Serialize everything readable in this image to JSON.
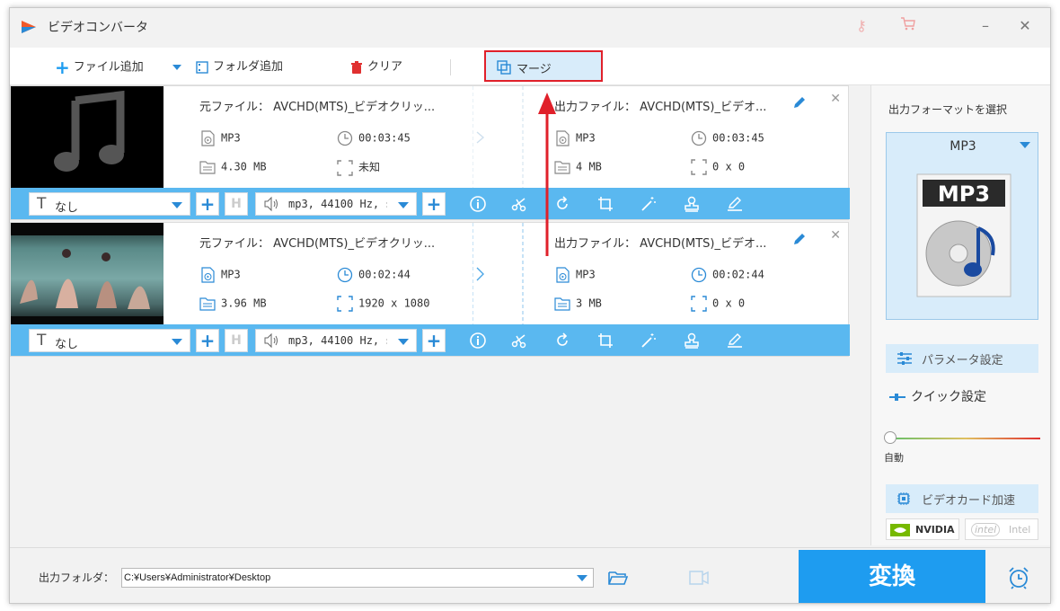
{
  "app": {
    "title": "ビデオコンバータ"
  },
  "toolbar": {
    "add_file": "ファイル追加",
    "add_folder": "フォルダ追加",
    "clear": "クリア",
    "merge": "マージ"
  },
  "items": [
    {
      "src_name": "元ファイル： AVCHD(MTS)_ビデオクリッ...",
      "out_name": "出力ファイル： AVCHD(MTS)_ビデオ...",
      "src_format": "MP3",
      "src_duration": "00:03:45",
      "src_size": "4.30 MB",
      "src_resolution": "未知",
      "out_format": "MP3",
      "out_duration": "00:03:45",
      "out_size": "4 MB",
      "out_resolution": "0 x 0",
      "subtitle": "なし",
      "audio": "mp3, 44100 Hz, s"
    },
    {
      "src_name": "元ファイル： AVCHD(MTS)_ビデオクリッ...",
      "out_name": "出力ファイル： AVCHD(MTS)_ビデオ...",
      "src_format": "MP3",
      "src_duration": "00:02:44",
      "src_size": "3.96 MB",
      "src_resolution": "1920 x 1080",
      "out_format": "MP3",
      "out_duration": "00:02:44",
      "out_size": "3 MB",
      "out_resolution": "0 x 0",
      "subtitle": "なし",
      "audio": "mp3, 44100 Hz, s"
    }
  ],
  "right_panel": {
    "title": "出力フォーマットを選択",
    "format": "MP3",
    "format_badge": "MP3",
    "param_settings": "パラメータ設定",
    "quick_settings": "クイック設定",
    "slider_label": "自動",
    "video_card": "ビデオカード加速",
    "nvidia": "NVIDIA",
    "intel": "Intel"
  },
  "bottom": {
    "output_folder_label": "出力フォルダ：",
    "output_path": "C:¥Users¥Administrator¥Desktop",
    "convert": "変換"
  },
  "colors": {
    "accent": "#1e9cf0",
    "bar": "#5ab8f0",
    "highlight": "#e0202a"
  }
}
